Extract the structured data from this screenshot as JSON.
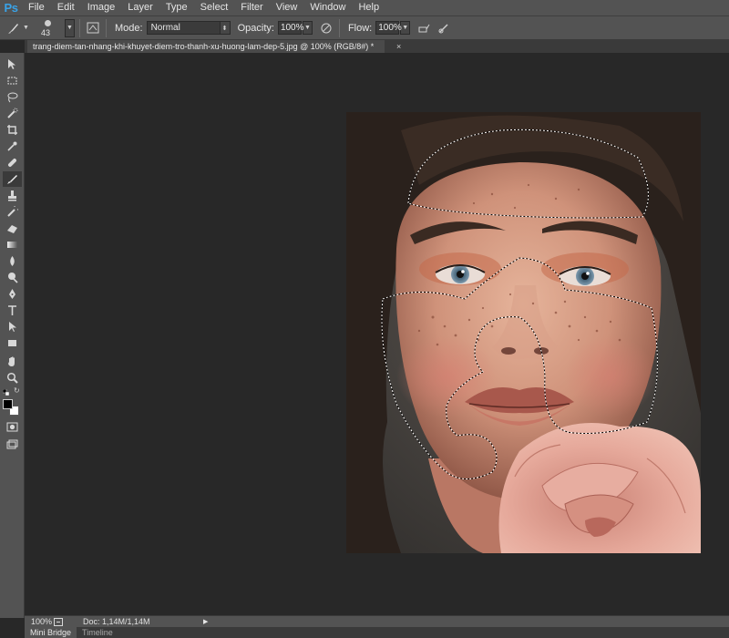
{
  "app": {
    "logo": "Ps"
  },
  "menu": [
    "File",
    "Edit",
    "Image",
    "Layer",
    "Type",
    "Select",
    "Filter",
    "View",
    "Window",
    "Help"
  ],
  "options": {
    "brush_size": "43",
    "mode_label": "Mode:",
    "mode_value": "Normal",
    "opacity_label": "Opacity:",
    "opacity_value": "100%",
    "flow_label": "Flow:",
    "flow_value": "100%"
  },
  "document": {
    "tab_title": "trang-diem-tan-nhang-khi-khuyet-diem-tro-thanh-xu-huong-lam-dep-5.jpg @ 100% (RGB/8#) *",
    "close_glyph": "×"
  },
  "status": {
    "zoom": "100%",
    "doc_info": "Doc: 1,14M/1,14M",
    "arrow": "▶"
  },
  "bottom_tabs": [
    "Mini Bridge",
    "Timeline"
  ],
  "colors": {
    "foreground": "#000000",
    "background": "#ffffff",
    "ui_panel": "#535353",
    "canvas_bg": "#282828",
    "ps_blue": "#39a3e8"
  },
  "tools": [
    "move-tool-icon",
    "marquee-tool-icon",
    "lasso-tool-icon",
    "quick-selection-tool-icon",
    "crop-tool-icon",
    "eyedropper-tool-icon",
    "healing-brush-tool-icon",
    "brush-tool-icon",
    "clone-stamp-tool-icon",
    "history-brush-tool-icon",
    "eraser-tool-icon",
    "gradient-tool-icon",
    "blur-tool-icon",
    "dodge-tool-icon",
    "pen-tool-icon",
    "type-tool-icon",
    "path-selection-tool-icon",
    "rectangle-tool-icon",
    "hand-tool-icon",
    "zoom-tool-icon"
  ]
}
